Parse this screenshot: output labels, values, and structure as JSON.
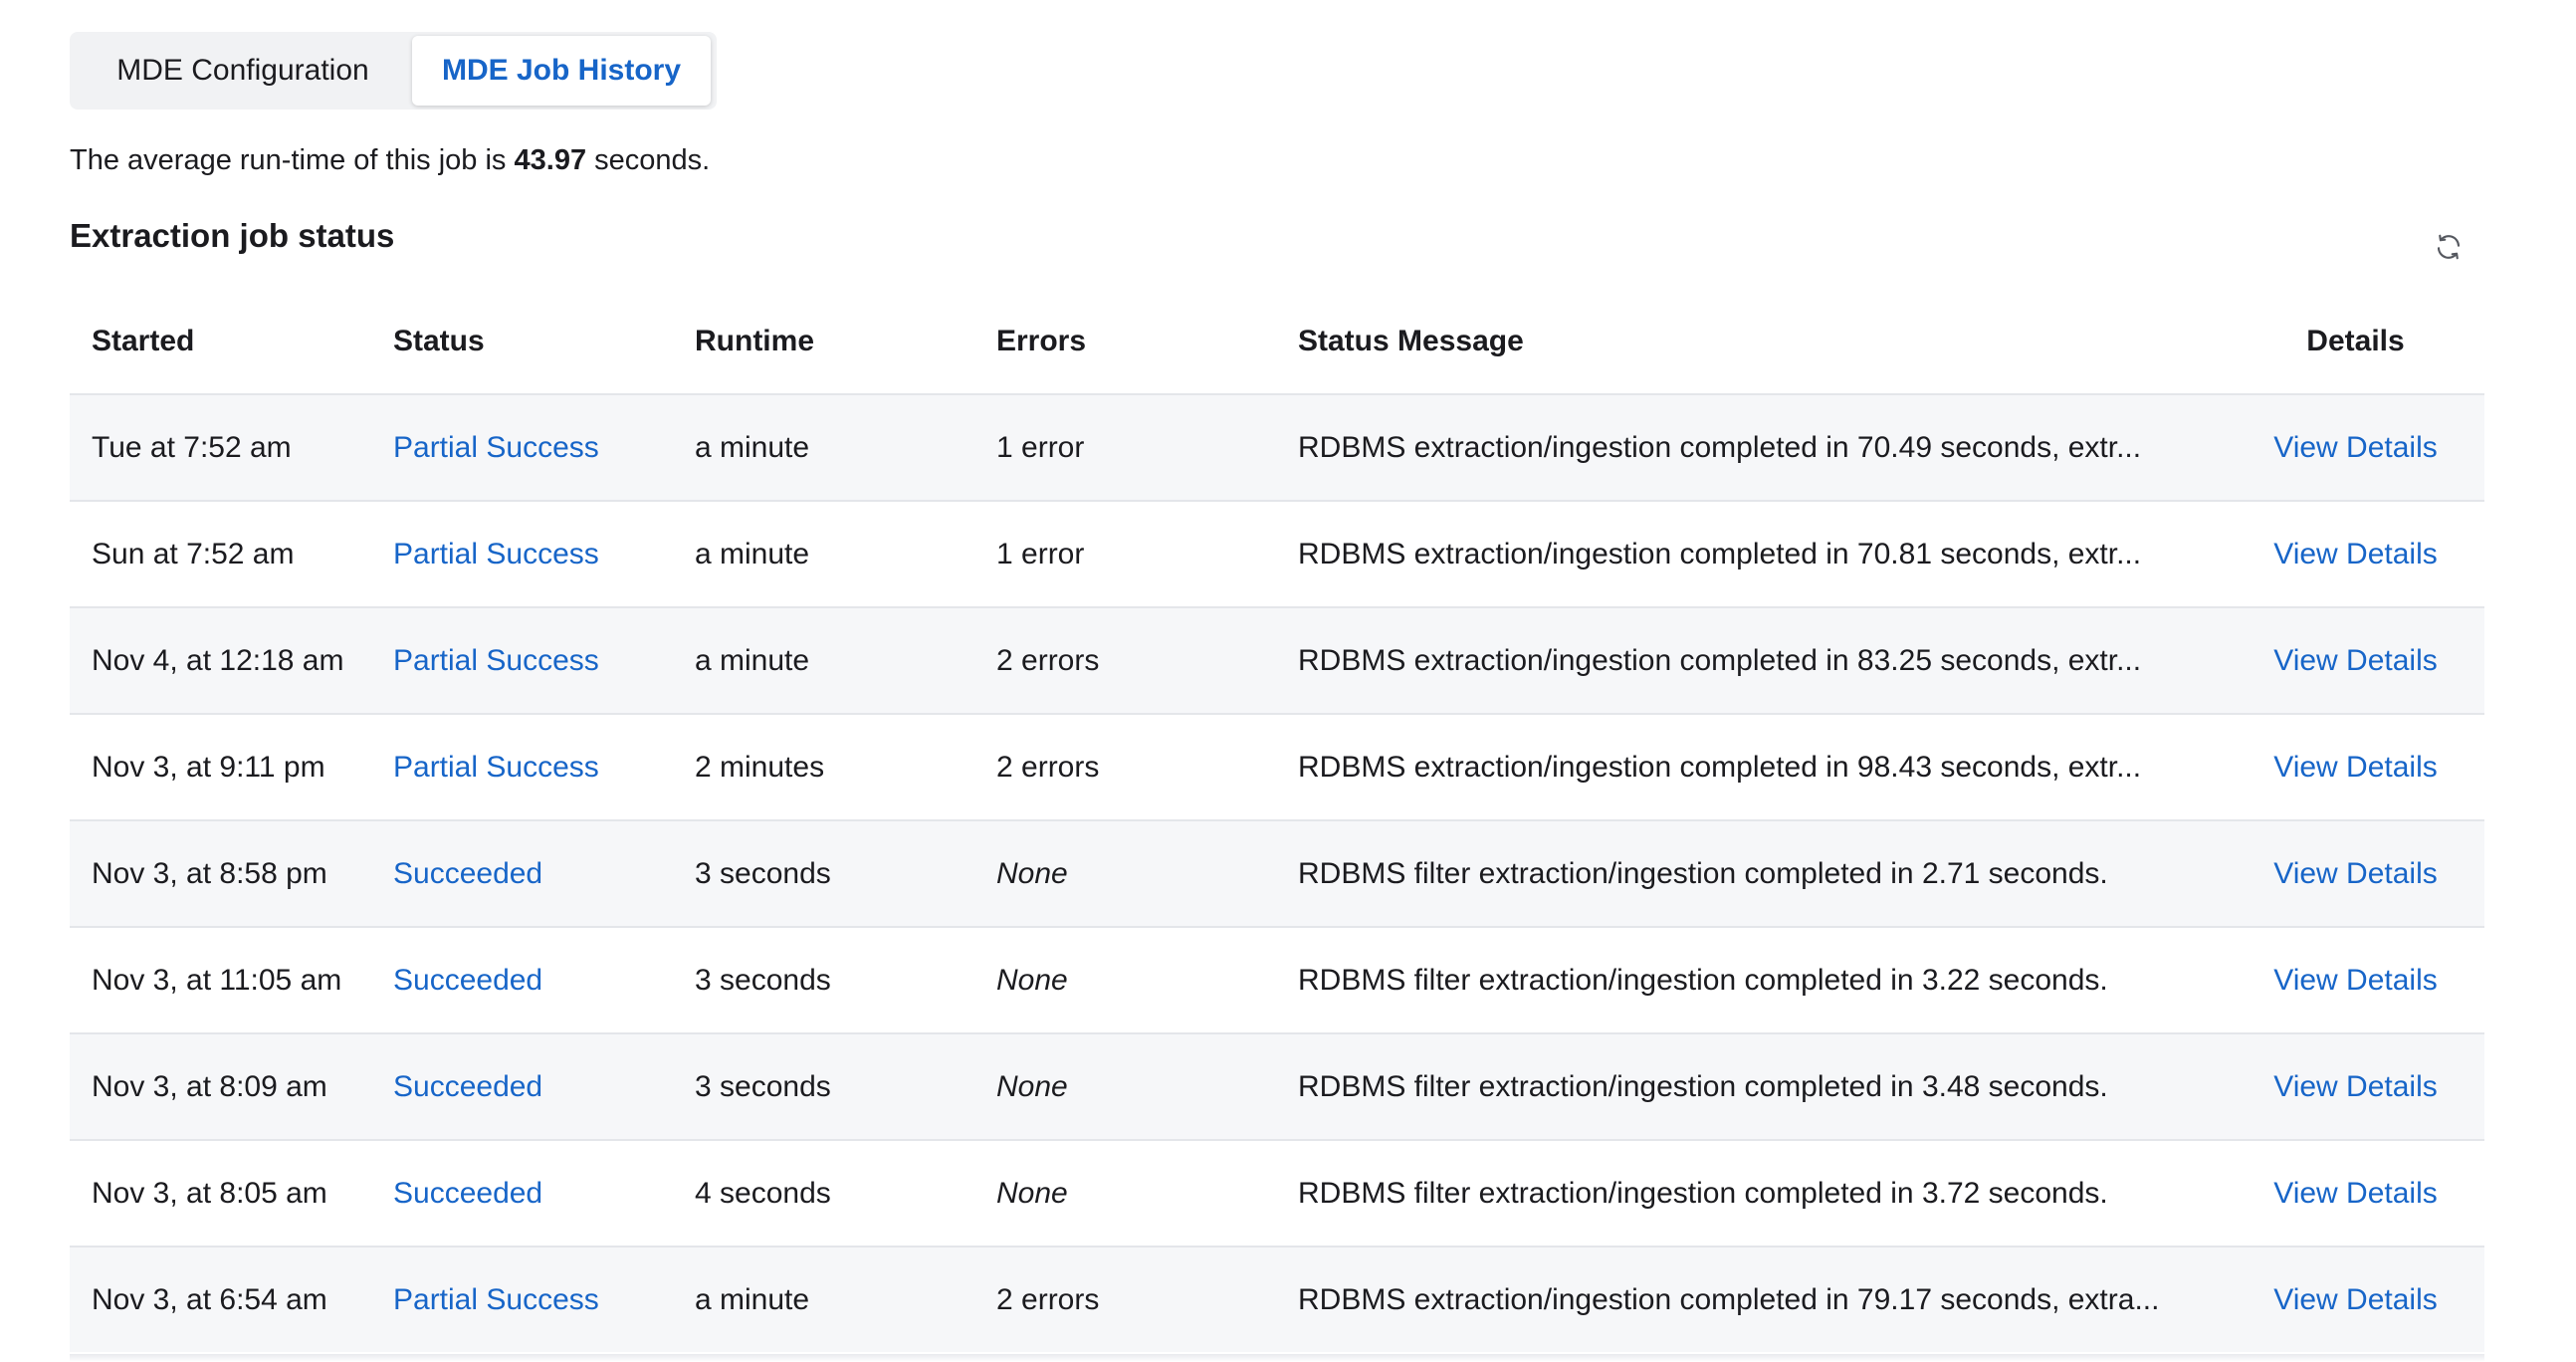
{
  "tabs": {
    "config_label": "MDE Configuration",
    "history_label": "MDE Job History"
  },
  "summary": {
    "prefix": "The average run-time of this job is",
    "value": "43.97",
    "suffix": "seconds."
  },
  "section": {
    "title": "Extraction job status",
    "refresh_icon": "refresh-icon"
  },
  "table": {
    "headers": [
      "Started",
      "Status",
      "Runtime",
      "Errors",
      "Status Message",
      "Details"
    ],
    "rows": [
      {
        "started": "Tue at 7:52 am",
        "status": "Partial Success",
        "runtime": "a minute",
        "errors": "1 error",
        "message": "RDBMS extraction/ingestion completed in 70.49 seconds, extr...",
        "details": "View Details"
      },
      {
        "started": "Sun at 7:52 am",
        "status": "Partial Success",
        "runtime": "a minute",
        "errors": "1 error",
        "message": "RDBMS extraction/ingestion completed in 70.81 seconds, extr...",
        "details": "View Details"
      },
      {
        "started": "Nov 4, at 12:18 am",
        "status": "Partial Success",
        "runtime": "a minute",
        "errors": "2 errors",
        "message": "RDBMS extraction/ingestion completed in 83.25 seconds, extr...",
        "details": "View Details"
      },
      {
        "started": "Nov 3, at 9:11 pm",
        "status": "Partial Success",
        "runtime": "2 minutes",
        "errors": "2 errors",
        "message": "RDBMS extraction/ingestion completed in 98.43 seconds, extr...",
        "details": "View Details"
      },
      {
        "started": "Nov 3, at 8:58 pm",
        "status": "Succeeded",
        "runtime": "3 seconds",
        "errors": "None",
        "message": "RDBMS filter extraction/ingestion completed in 2.71 seconds.",
        "details": "View Details"
      },
      {
        "started": "Nov 3, at 11:05 am",
        "status": "Succeeded",
        "runtime": "3 seconds",
        "errors": "None",
        "message": "RDBMS filter extraction/ingestion completed in 3.22 seconds.",
        "details": "View Details"
      },
      {
        "started": "Nov 3, at 8:09 am",
        "status": "Succeeded",
        "runtime": "3 seconds",
        "errors": "None",
        "message": "RDBMS filter extraction/ingestion completed in 3.48 seconds.",
        "details": "View Details"
      },
      {
        "started": "Nov 3, at 8:05 am",
        "status": "Succeeded",
        "runtime": "4 seconds",
        "errors": "None",
        "message": "RDBMS filter extraction/ingestion completed in 3.72 seconds.",
        "details": "View Details"
      },
      {
        "started": "Nov 3, at 6:54 am",
        "status": "Partial Success",
        "runtime": "a minute",
        "errors": "2 errors",
        "message": "RDBMS extraction/ingestion completed in 79.17 seconds, extra...",
        "details": "View Details"
      }
    ]
  },
  "colors": {
    "link": "#1765c8",
    "text": "#1b1b1f",
    "row_alt": "#f6f7f9"
  }
}
